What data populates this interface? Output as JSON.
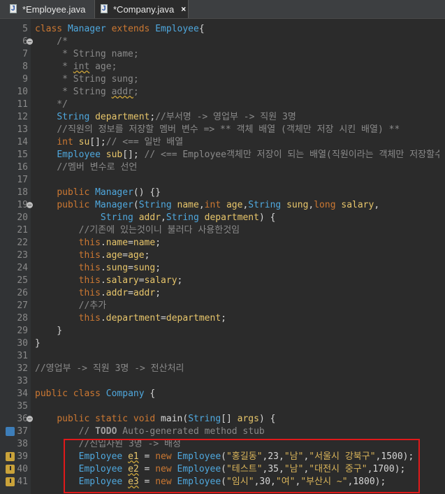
{
  "tabs": [
    {
      "label": "*Employee.java",
      "active": false,
      "icon": "java-file-icon"
    },
    {
      "label": "*Company.java",
      "active": true,
      "icon": "java-file-icon",
      "close_icon": "×"
    }
  ],
  "code_lines": [
    {
      "num": "5",
      "text": "class Manager extends Employee{"
    },
    {
      "num": "6",
      "text": "    /*"
    },
    {
      "num": "7",
      "text": "     * String name;"
    },
    {
      "num": "8",
      "text": "     * int age;"
    },
    {
      "num": "9",
      "text": "     * String sung;"
    },
    {
      "num": "10",
      "text": "     * String addr;"
    },
    {
      "num": "11",
      "text": "    */"
    },
    {
      "num": "12",
      "text": "    String department;//부서명 -> 영업부 -> 직원 3명"
    },
    {
      "num": "13",
      "text": "    //직원의 정보를 저장할 멤버 변수 => ** 객체 배열 (객체만 저장 시킨 배열) **"
    },
    {
      "num": "14",
      "text": "    int su[];// <== 일반 배열"
    },
    {
      "num": "15",
      "text": "    Employee sub[]; // <== Employee객체만 저장이 되는 배열(직원이라는 객체만 저장할수있는)"
    },
    {
      "num": "16",
      "text": "    //멤버 변수로 선언"
    },
    {
      "num": "17",
      "text": ""
    },
    {
      "num": "18",
      "text": "    public Manager() {}"
    },
    {
      "num": "19",
      "text": "    public Manager(String name,int age,String sung,long salary,"
    },
    {
      "num": "20",
      "text": "            String addr,String department) {"
    },
    {
      "num": "21",
      "text": "        //기존에 있는것이니 불러다 사용한것임"
    },
    {
      "num": "22",
      "text": "        this.name=name;"
    },
    {
      "num": "23",
      "text": "        this.age=age;"
    },
    {
      "num": "24",
      "text": "        this.sung=sung;"
    },
    {
      "num": "25",
      "text": "        this.salary=salary;"
    },
    {
      "num": "26",
      "text": "        this.addr=addr;"
    },
    {
      "num": "27",
      "text": "        //추가"
    },
    {
      "num": "28",
      "text": "        this.department=department;"
    },
    {
      "num": "29",
      "text": "    }"
    },
    {
      "num": "30",
      "text": "}"
    },
    {
      "num": "31",
      "text": ""
    },
    {
      "num": "32",
      "text": "//영업부 -> 직원 3명 -> 전산처리"
    },
    {
      "num": "33",
      "text": ""
    },
    {
      "num": "34",
      "text": "public class Company {"
    },
    {
      "num": "35",
      "text": ""
    },
    {
      "num": "36",
      "text": "    public static void main(String[] args) {"
    },
    {
      "num": "37",
      "text": "        // TODO Auto-generated method stub"
    },
    {
      "num": "38",
      "text": "        //신입사원 3명 -> 배정"
    },
    {
      "num": "39",
      "text": "        Employee e1 = new Employee(\"홍길동\",23,\"남\",\"서울시 강북구\",1500);"
    },
    {
      "num": "40",
      "text": "        Employee e2 = new Employee(\"테스트\",35,\"남\",\"대전시 중구\",1700);"
    },
    {
      "num": "41",
      "text": "        Employee e3 = new Employee(\"임시\",30,\"여\",\"부산시 ~\",1800);"
    }
  ],
  "gutter_markers": {
    "fold_lines": [
      "6",
      "19",
      "36"
    ],
    "warning_lines": [
      "39",
      "40",
      "41"
    ],
    "override_line": "37"
  },
  "highlight_box_color": "#e0191a"
}
